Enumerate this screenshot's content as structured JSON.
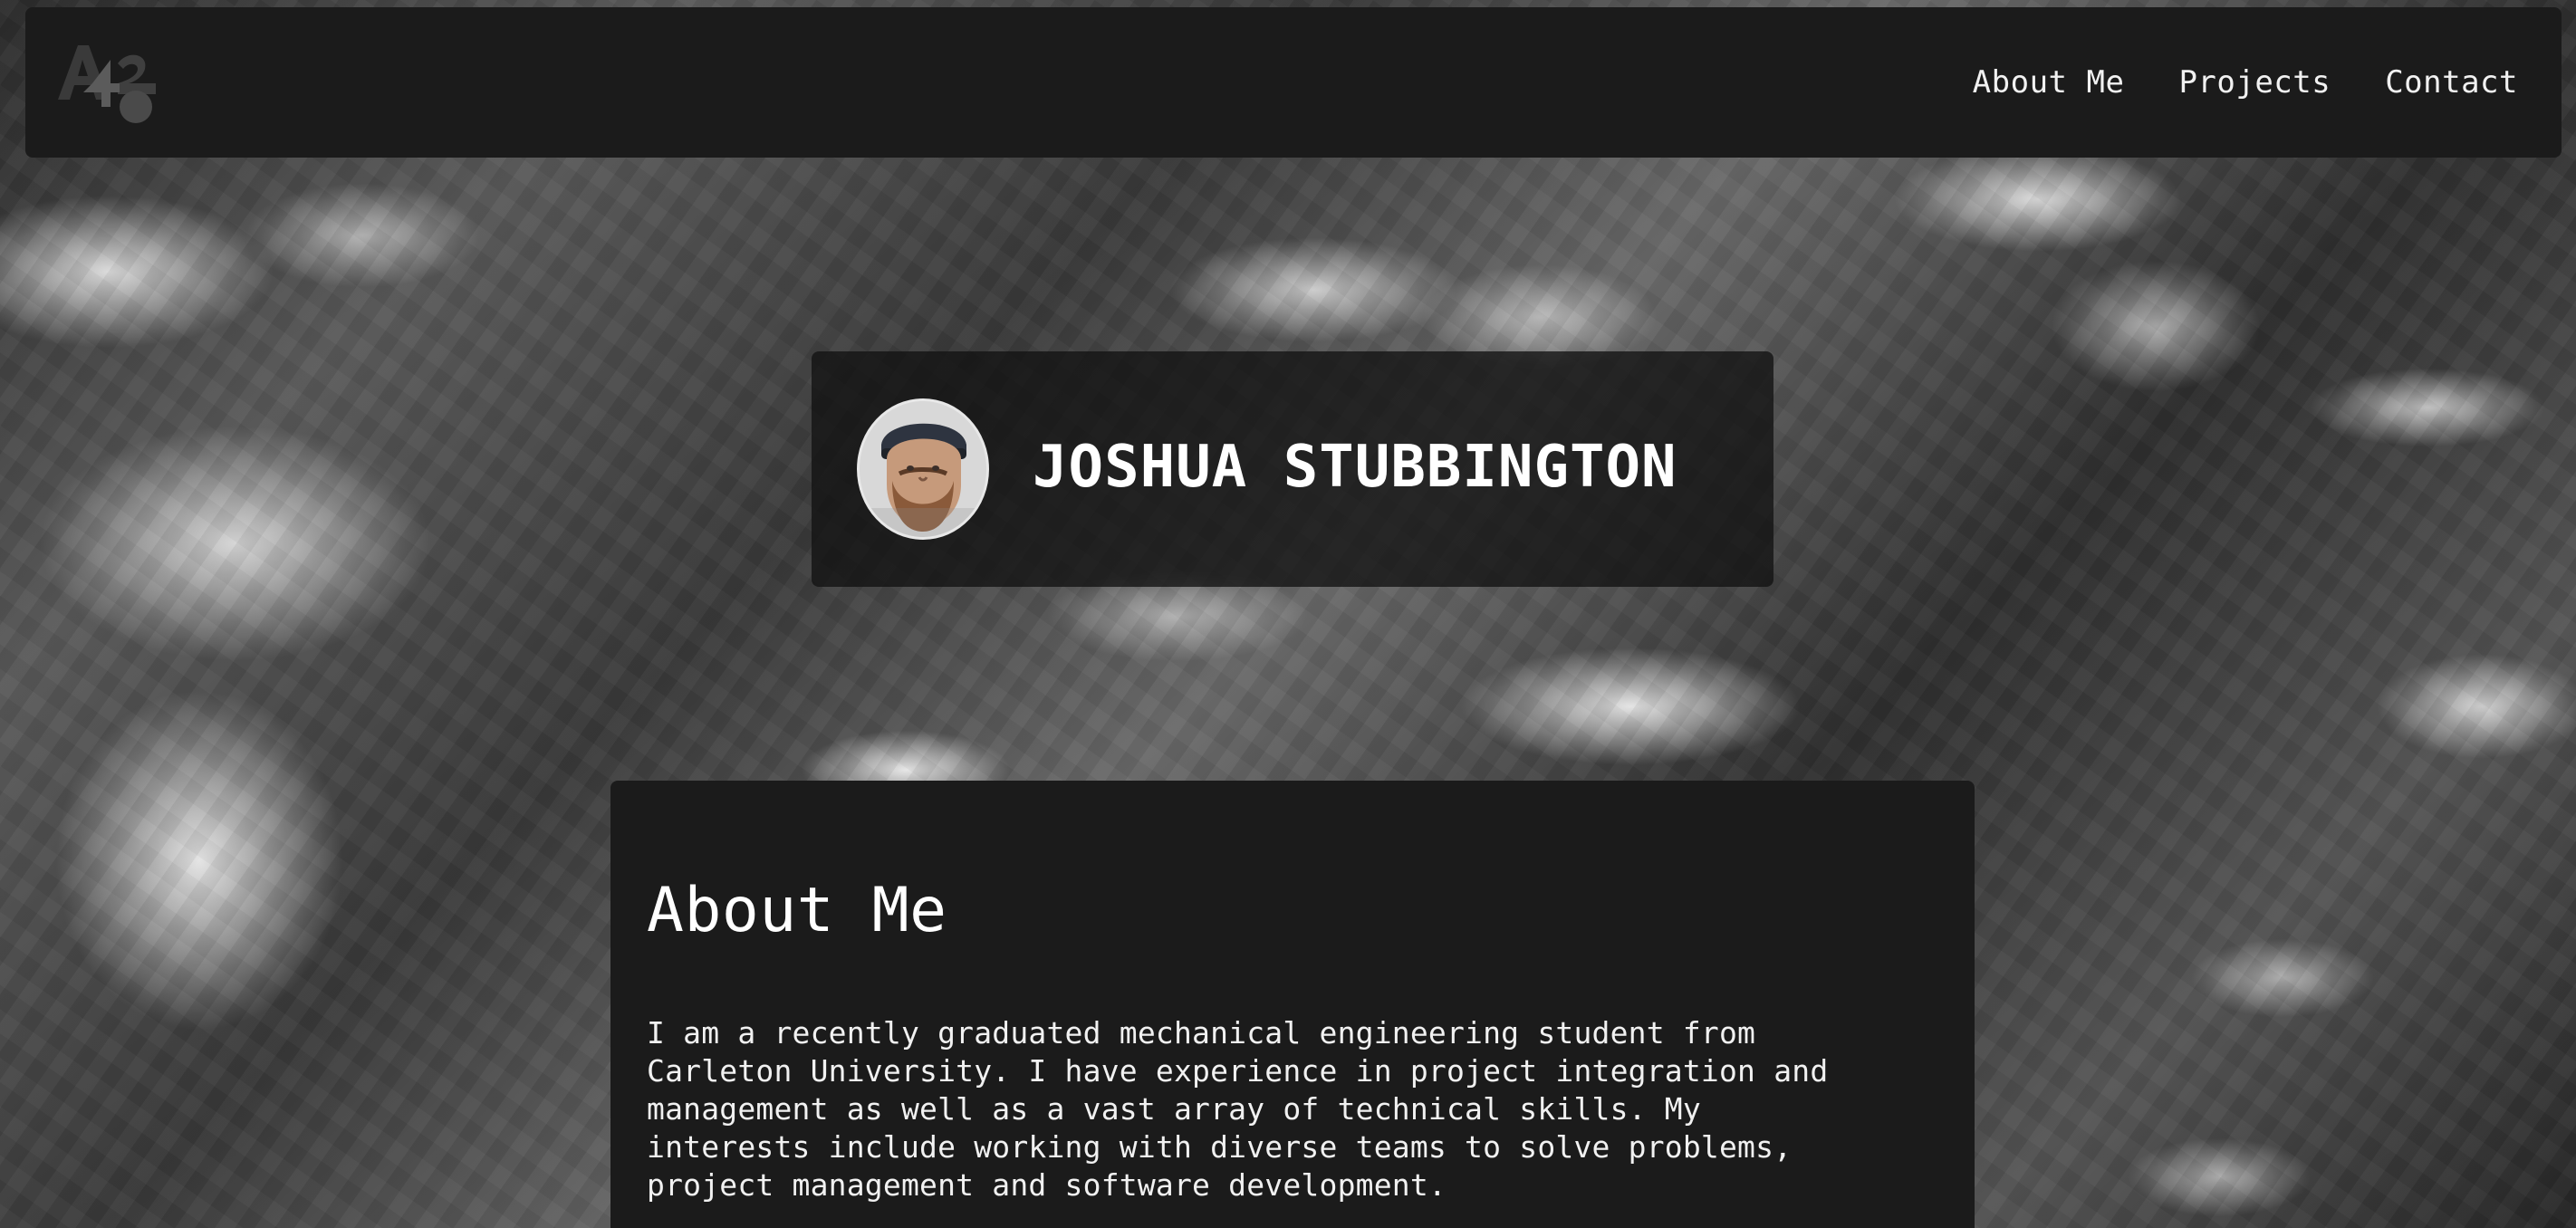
{
  "nav": {
    "items": [
      {
        "label": "About Me"
      },
      {
        "label": "Projects"
      },
      {
        "label": "Contact"
      }
    ]
  },
  "hero": {
    "name": "JOSHUA STUBBINGTON",
    "avatar_icon": "profile-photo"
  },
  "about": {
    "title": "About Me",
    "text": "I am a recently graduated mechanical engineering student from Carleton University. I have experience in project integration and management as well as a vast array of technical skills. My interests include working with diverse teams to solve problems, project management and software development."
  },
  "colors": {
    "panel": "#1b1b1b",
    "hero_panel": "#121212",
    "text": "#f1f1f1"
  },
  "icons": {
    "logo": "brand-logo"
  }
}
